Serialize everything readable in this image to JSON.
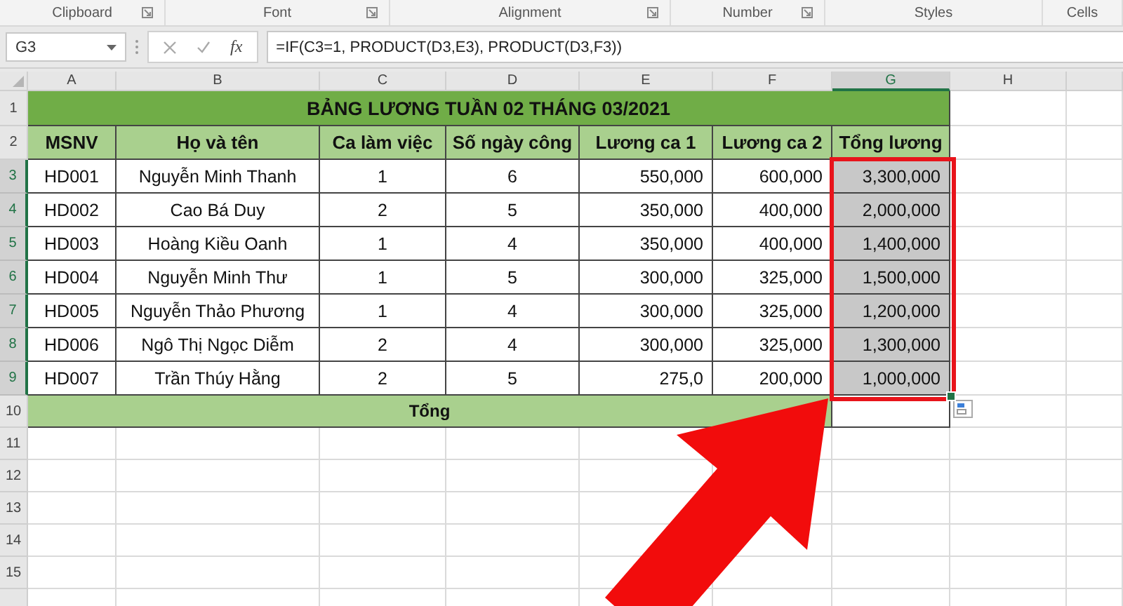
{
  "ribbon_groups": [
    {
      "label": "Clipboard",
      "launcher": true
    },
    {
      "label": "Font",
      "launcher": true
    },
    {
      "label": "Alignment",
      "launcher": true
    },
    {
      "label": "Number",
      "launcher": true
    },
    {
      "label": "Styles",
      "launcher": false
    },
    {
      "label": "Cells",
      "launcher": false
    }
  ],
  "formula_bar": {
    "name_box": "G3",
    "function_button": "fx",
    "formula": "=IF(C3=1, PRODUCT(D3,E3), PRODUCT(D3,F3))"
  },
  "sheet": {
    "columns": [
      {
        "label": "A",
        "selected": false
      },
      {
        "label": "B",
        "selected": false
      },
      {
        "label": "C",
        "selected": false
      },
      {
        "label": "D",
        "selected": false
      },
      {
        "label": "E",
        "selected": false
      },
      {
        "label": "F",
        "selected": false
      },
      {
        "label": "G",
        "selected": true
      },
      {
        "label": "H",
        "selected": false
      }
    ],
    "title_row": {
      "number": "1",
      "selected": false,
      "title": "BẢNG LƯƠNG TUẦN 02 THÁNG 03/2021"
    },
    "header_row": {
      "number": "2",
      "selected": false,
      "headers": [
        "MSNV",
        "Họ và tên",
        "Ca làm việc",
        "Số ngày công",
        "Lương ca 1",
        "Lương ca 2",
        "Tổng lương"
      ]
    },
    "rows": [
      {
        "number": "3",
        "selected": true,
        "cells": [
          "HD001",
          "Nguyễn Minh Thanh",
          "1",
          "6",
          "550,000",
          "600,000",
          "3,300,000"
        ]
      },
      {
        "number": "4",
        "selected": true,
        "cells": [
          "HD002",
          "Cao Bá Duy",
          "2",
          "5",
          "350,000",
          "400,000",
          "2,000,000"
        ]
      },
      {
        "number": "5",
        "selected": true,
        "cells": [
          "HD003",
          "Hoàng Kiều Oanh",
          "1",
          "4",
          "350,000",
          "400,000",
          "1,400,000"
        ]
      },
      {
        "number": "6",
        "selected": true,
        "cells": [
          "HD004",
          "Nguyễn Minh Thư",
          "1",
          "5",
          "300,000",
          "325,000",
          "1,500,000"
        ]
      },
      {
        "number": "7",
        "selected": true,
        "cells": [
          "HD005",
          "Nguyễn Thảo Phương",
          "1",
          "4",
          "300,000",
          "325,000",
          "1,200,000"
        ]
      },
      {
        "number": "8",
        "selected": true,
        "cells": [
          "HD006",
          "Ngô Thị Ngọc Diễm",
          "2",
          "4",
          "300,000",
          "325,000",
          "1,300,000"
        ]
      },
      {
        "number": "9",
        "selected": true,
        "cells": [
          "HD007",
          "Trần Thúy Hằng",
          "2",
          "5",
          "275,0",
          "200,000",
          "1,000,000"
        ]
      }
    ],
    "total_row": {
      "number": "10",
      "selected": false,
      "label": "Tổng"
    },
    "empty_rows": [
      {
        "number": "11",
        "selected": false
      },
      {
        "number": "12",
        "selected": false
      },
      {
        "number": "13",
        "selected": false
      },
      {
        "number": "14",
        "selected": false
      },
      {
        "number": "15",
        "selected": false
      }
    ]
  }
}
